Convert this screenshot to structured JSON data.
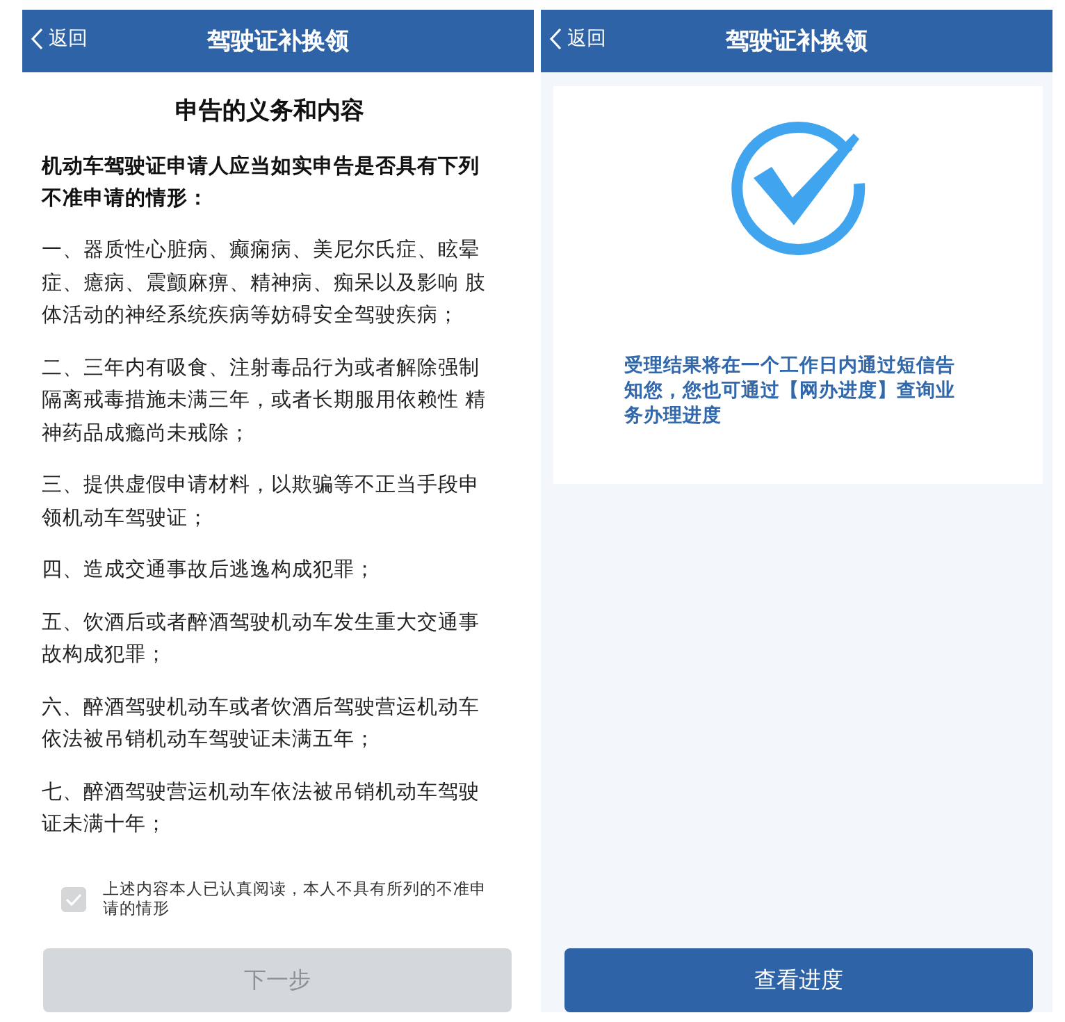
{
  "screens": [
    {
      "kind": "declaration",
      "back": "返回",
      "title": "驾驶证补换领",
      "heading": "申告的义务和内容",
      "intro": "机动车驾驶证申请人应当如实申告是否具有下列不准申请的情形：",
      "items": [
        "一、器质性心脏病、癫痫病、美尼尔氏症、眩晕症、癔病、震颤麻痹、精神病、痴呆以及影响 肢体活动的神经系统疾病等妨碍安全驾驶疾病；",
        "二、三年内有吸食、注射毒品行为或者解除强制隔离戒毒措施未满三年，或者长期服用依赖性 精神药品成瘾尚未戒除；",
        "三、提供虚假申请材料，以欺骗等不正当手段申领机动车驾驶证；",
        "四、造成交通事故后逃逸构成犯罪；",
        "五、饮酒后或者醉酒驾驶机动车发生重大交通事故构成犯罪；",
        "六、醉酒驾驶机动车或者饮酒后驾驶营运机动车依法被吊销机动车驾驶证未满五年；",
        "七、醉酒驾驶营运机动车依法被吊销机动车驾驶证未满十年；"
      ],
      "agreement": {
        "text": "上述内容本人已认真阅读，本人不具有所列的不准申请的情形",
        "checked": true
      },
      "button": {
        "label": "下一步",
        "disabled": true
      }
    },
    {
      "kind": "result",
      "back": "返回",
      "title": "驾驶证补换领",
      "message": "受理结果将在一个工作日内通过短信告知您，您也可通过【网办进度】查询业务办理进度",
      "button": {
        "label": "查看进度",
        "disabled": false
      }
    }
  ]
}
